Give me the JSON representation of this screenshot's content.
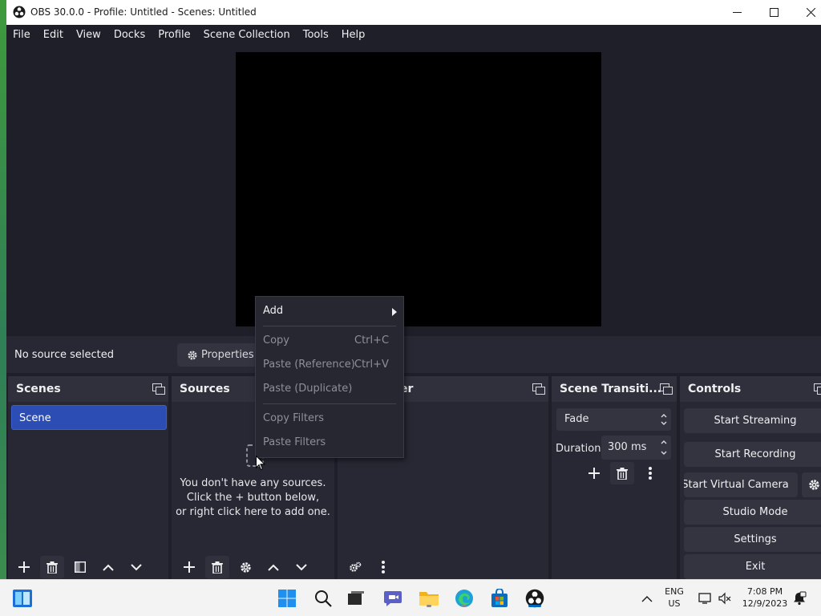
{
  "window": {
    "title": "OBS 30.0.0 - Profile: Untitled - Scenes: Untitled"
  },
  "menu": [
    "File",
    "Edit",
    "View",
    "Docks",
    "Profile",
    "Scene Collection",
    "Tools",
    "Help"
  ],
  "source_toolbar": {
    "status": "No source selected",
    "properties_label": "Properties"
  },
  "docks": {
    "scenes": {
      "title": "Scenes",
      "items": [
        "Scene"
      ]
    },
    "sources": {
      "title": "Sources",
      "empty_line1": "You don't have any sources.",
      "empty_line2": "Click the + button below,",
      "empty_line3": "or right click here to add one."
    },
    "mixer": {
      "title_visible": "er"
    },
    "transitions": {
      "title": "Scene Transiti...",
      "selected": "Fade",
      "duration_label": "Duration",
      "duration_value": "300 ms"
    },
    "controls": {
      "title": "Controls",
      "start_streaming": "Start Streaming",
      "start_recording": "Start Recording",
      "start_virtual_camera": "Start Virtual Camera",
      "studio_mode": "Studio Mode",
      "settings": "Settings",
      "exit": "Exit"
    }
  },
  "context_menu": {
    "add": "Add",
    "copy": "Copy",
    "copy_shortcut": "Ctrl+C",
    "paste_reference": "Paste (Reference)",
    "paste_reference_shortcut": "Ctrl+V",
    "paste_duplicate": "Paste (Duplicate)",
    "copy_filters": "Copy Filters",
    "paste_filters": "Paste Filters"
  },
  "taskbar": {
    "lang_line1": "ENG",
    "lang_line2": "US",
    "time": "7:08 PM",
    "date": "12/9/2023"
  },
  "colors": {
    "accent_scene": "#2b4db4",
    "panel": "#272833",
    "background": "#1e1f29"
  }
}
